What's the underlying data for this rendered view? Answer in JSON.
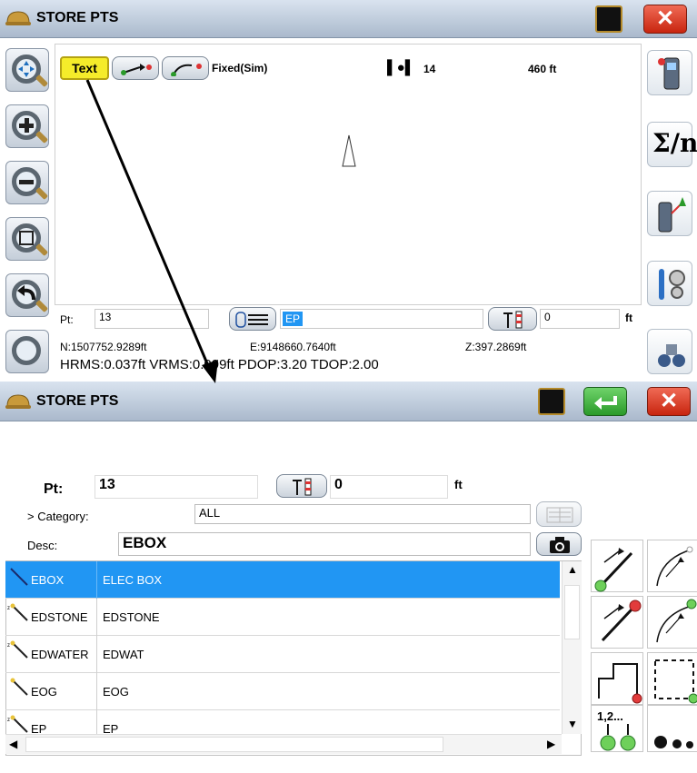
{
  "top_window": {
    "title": "STORE PTS",
    "toolbar": {
      "text_button": "Text",
      "status": "Fixed(Sim)",
      "satellites": "14",
      "distance": "460 ft"
    },
    "point_bar": {
      "pt_label": "Pt:",
      "pt_value": "13",
      "desc_value": "EP",
      "height_value": "0",
      "unit": "ft"
    },
    "coords": {
      "north": "N:1507752.9289ft",
      "east": "E:9148660.7640ft",
      "elev": "Z:397.2869ft"
    },
    "quality_line": "HRMS:0.037ft VRMS:0.099ft PDOP:3.20 TDOP:2.00"
  },
  "bottom_window": {
    "title": "STORE PTS",
    "pt_label": "Pt:",
    "pt_value": "13",
    "height_value": "0",
    "unit": "ft",
    "category_label": "> Category:",
    "category_value": "ALL",
    "desc_label": "Desc:",
    "desc_value": "EBOX",
    "codes": [
      {
        "code": "EBOX",
        "desc": "ELEC BOX",
        "selected": true
      },
      {
        "code": "EDSTONE",
        "desc": "EDSTONE",
        "selected": false
      },
      {
        "code": "EDWATER",
        "desc": "EDWAT",
        "selected": false
      },
      {
        "code": "EOG",
        "desc": "EOG",
        "selected": false
      },
      {
        "code": "EP",
        "desc": "EP",
        "selected": false
      }
    ],
    "numbering_label": "1,2..."
  },
  "colors": {
    "accent": "#2196f3",
    "close": "#d3321c",
    "ok": "#3aa83a"
  },
  "icons": [
    "hardhat-icon",
    "zoom-extents-icon",
    "zoom-in-icon",
    "zoom-out-icon",
    "zoom-window-icon",
    "zoom-previous-icon",
    "close-icon",
    "enter-icon",
    "camera-icon",
    "rod-icon",
    "sigma-icon"
  ]
}
